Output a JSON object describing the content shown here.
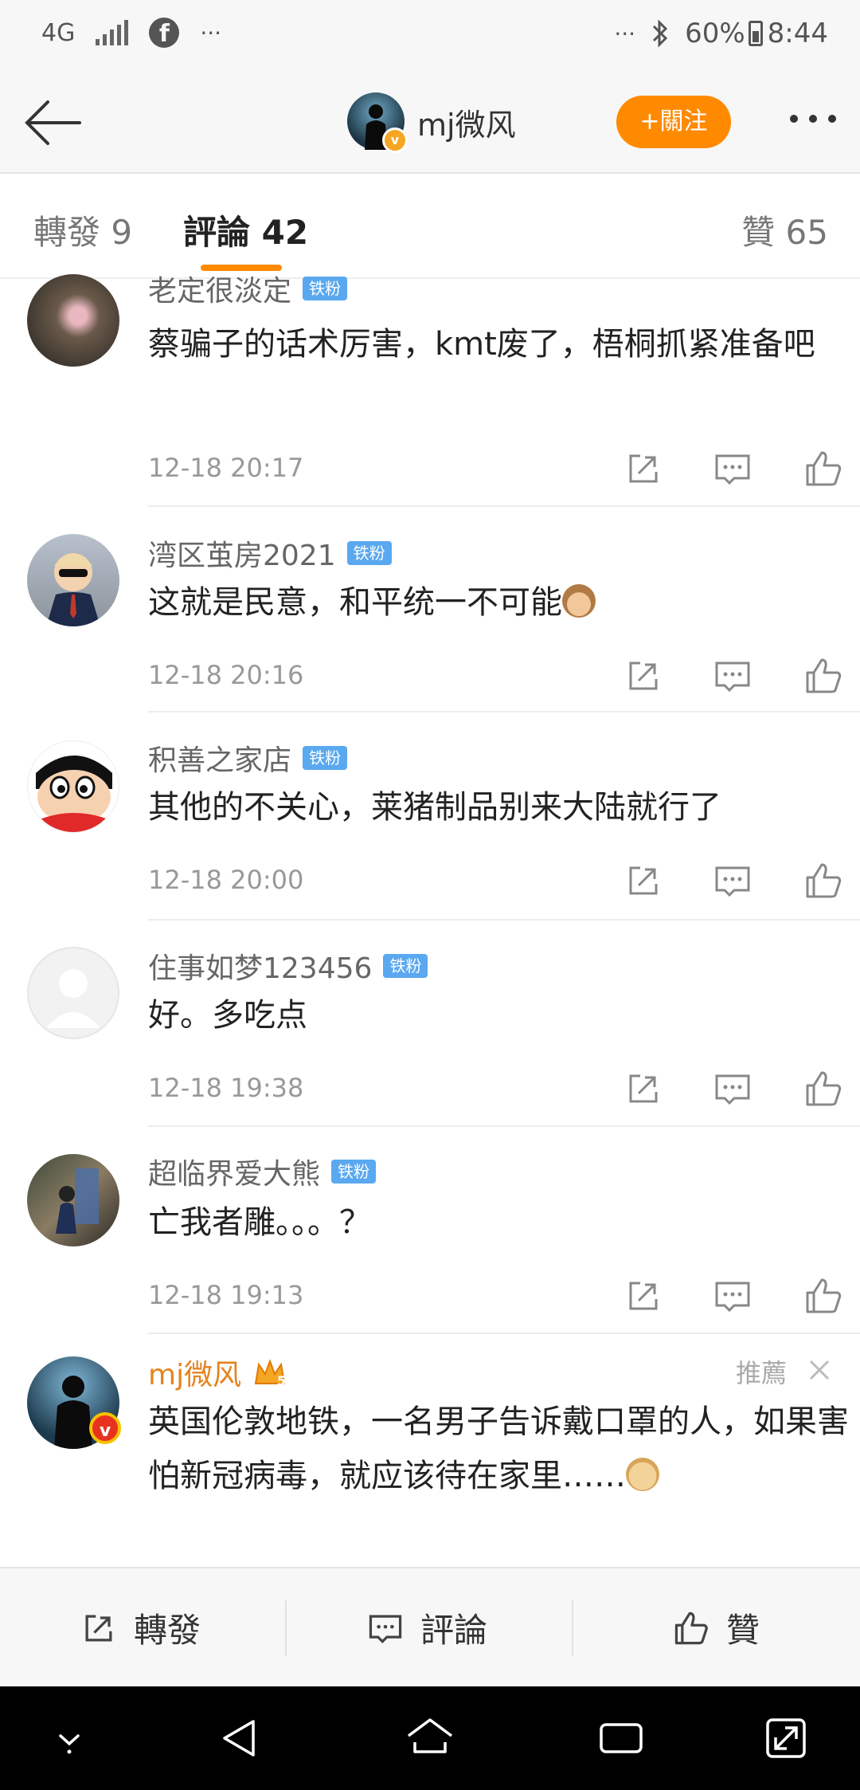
{
  "status_bar": {
    "network": "4G",
    "left_icons": [
      "signal-icon",
      "facebook-icon",
      "more-notifications-icon"
    ],
    "right_overflow": "···",
    "battery": "60%",
    "time": "8:44"
  },
  "header": {
    "user_name": "mj微风",
    "follow_label": "+關注"
  },
  "tabs": [
    {
      "label": "轉發 9",
      "active": false
    },
    {
      "label": "評論 42",
      "active": true
    },
    {
      "label": "贊 65",
      "active": false
    }
  ],
  "comments": [
    {
      "user": "老定很淡定",
      "badge": "铁粉",
      "text": "蔡骗子的话术厉害，kmt废了，梧桐抓紧准备吧",
      "time": "12-18 20:17",
      "avatar": "flower-avatar"
    },
    {
      "user": "湾区茧房2021",
      "badge": "铁粉",
      "text": "这就是民意，和平统一不可能",
      "emoji": "see-no-evil-monkey",
      "time": "12-18 20:16",
      "avatar": "cartoon-businessman-avatar"
    },
    {
      "user": "积善之家店",
      "badge": "铁粉",
      "text": "其他的不关心，莱猪制品别来大陆就行了",
      "time": "12-18 20:00",
      "avatar": "crayon-shinchan-avatar"
    },
    {
      "user": "住事如梦123456",
      "badge": "铁粉",
      "text": "好。多吃点",
      "time": "12-18 19:38",
      "avatar": "default-user-avatar"
    },
    {
      "user": "超临界爱大熊",
      "badge": "铁粉",
      "text": "亡我者雕。。。？",
      "time": "12-18 19:13",
      "avatar": "photo-avatar"
    }
  ],
  "recommended": {
    "user": "mj微风",
    "level": "5",
    "tag": "推薦",
    "text": "英国伦敦地铁，一名男子告诉戴口罩的人，如果害怕新冠病毒，就应该待在家里……",
    "emoji": "doge",
    "avatar": "soldier-silhouette-avatar"
  },
  "bottom_bar": {
    "repost": "轉發",
    "comment": "評論",
    "like": "贊"
  },
  "colors": {
    "accent": "#ff8a00",
    "badge_blue": "#5aa8f0",
    "username_orange": "#e5831e"
  }
}
